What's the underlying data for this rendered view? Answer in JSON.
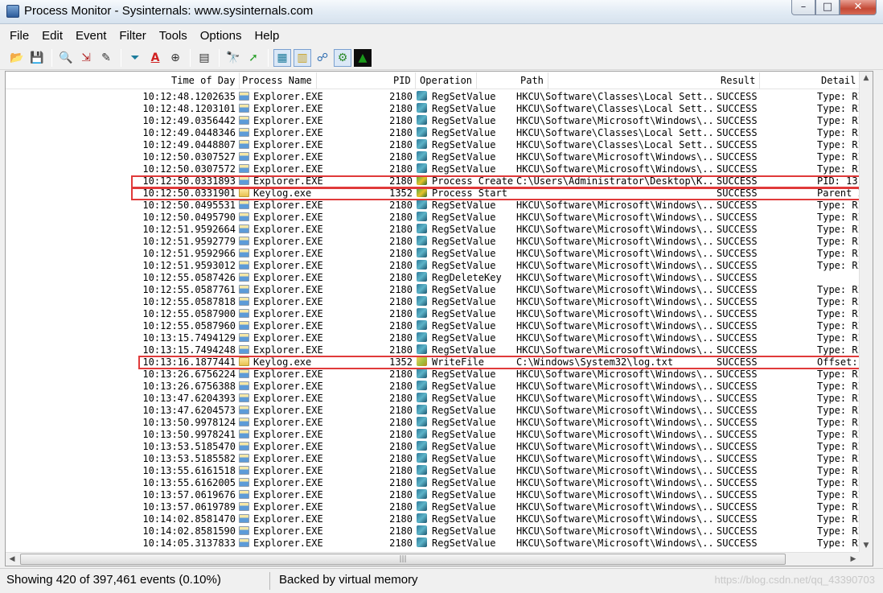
{
  "window": {
    "title": "Process Monitor - Sysinternals: www.sysinternals.com"
  },
  "menu": [
    "File",
    "Edit",
    "Event",
    "Filter",
    "Tools",
    "Options",
    "Help"
  ],
  "toolbar": {
    "buttons": [
      {
        "icon": "open-folder-icon",
        "glyph": "📂"
      },
      {
        "icon": "save-icon",
        "glyph": "💾"
      },
      {
        "icon": "capture-magnifier-icon",
        "glyph": "🔍"
      },
      {
        "icon": "autoscroll-icon",
        "glyph": "⇲"
      },
      {
        "icon": "clear-display-icon",
        "glyph": "✎"
      },
      {
        "icon": "filter-icon",
        "glyph": "⏷"
      },
      {
        "icon": "highlight-icon",
        "glyph": "A"
      },
      {
        "icon": "target-icon",
        "glyph": "⊕"
      },
      {
        "icon": "event-properties-icon",
        "glyph": "▤"
      },
      {
        "icon": "find-binoculars-icon",
        "glyph": "🔭"
      },
      {
        "icon": "jump-to-icon",
        "glyph": "➚"
      },
      {
        "icon": "registry-activity-icon",
        "glyph": "▦"
      },
      {
        "icon": "file-activity-icon",
        "glyph": "▥"
      },
      {
        "icon": "network-activity-icon",
        "glyph": "☍"
      },
      {
        "icon": "process-thread-activity-icon",
        "glyph": "⚙"
      },
      {
        "icon": "profiling-events-icon",
        "glyph": "▲"
      }
    ]
  },
  "columns": {
    "time": "Time of Day",
    "process": "Process Name",
    "pid": "PID",
    "operation": "Operation",
    "path": "Path",
    "result": "Result",
    "detail": "Detail"
  },
  "rows": [
    {
      "time": "10:12:48.1202635",
      "proc": "Explorer.EXE",
      "pid": "2180",
      "op": "RegSetValue",
      "path": "HKCU\\Software\\Classes\\Local Sett...",
      "result": "SUCCESS",
      "detail": "Type: RI"
    },
    {
      "time": "10:12:48.1203101",
      "proc": "Explorer.EXE",
      "pid": "2180",
      "op": "RegSetValue",
      "path": "HKCU\\Software\\Classes\\Local Sett...",
      "result": "SUCCESS",
      "detail": "Type: RI"
    },
    {
      "time": "10:12:49.0356442",
      "proc": "Explorer.EXE",
      "pid": "2180",
      "op": "RegSetValue",
      "path": "HKCU\\Software\\Microsoft\\Windows\\...",
      "result": "SUCCESS",
      "detail": "Type: RI"
    },
    {
      "time": "10:12:49.0448346",
      "proc": "Explorer.EXE",
      "pid": "2180",
      "op": "RegSetValue",
      "path": "HKCU\\Software\\Classes\\Local Sett...",
      "result": "SUCCESS",
      "detail": "Type: RI"
    },
    {
      "time": "10:12:49.0448807",
      "proc": "Explorer.EXE",
      "pid": "2180",
      "op": "RegSetValue",
      "path": "HKCU\\Software\\Classes\\Local Sett...",
      "result": "SUCCESS",
      "detail": "Type: RI"
    },
    {
      "time": "10:12:50.0307527",
      "proc": "Explorer.EXE",
      "pid": "2180",
      "op": "RegSetValue",
      "path": "HKCU\\Software\\Microsoft\\Windows\\...",
      "result": "SUCCESS",
      "detail": "Type: RI"
    },
    {
      "time": "10:12:50.0307572",
      "proc": "Explorer.EXE",
      "pid": "2180",
      "op": "RegSetValue",
      "path": "HKCU\\Software\\Microsoft\\Windows\\...",
      "result": "SUCCESS",
      "detail": "Type: RI"
    },
    {
      "time": "10:12:50.0331893",
      "proc": "Explorer.EXE",
      "pid": "2180",
      "op": "Process Create",
      "path": "C:\\Users\\Administrator\\Desktop\\K...",
      "result": "SUCCESS",
      "detail": "PID: 13"
    },
    {
      "time": "10:12:50.0331901",
      "proc": "Keylog.exe",
      "pid": "1352",
      "op": "Process Start",
      "path": "",
      "result": "SUCCESS",
      "detail": "Parent I"
    },
    {
      "time": "10:12:50.0495531",
      "proc": "Explorer.EXE",
      "pid": "2180",
      "op": "RegSetValue",
      "path": "HKCU\\Software\\Microsoft\\Windows\\...",
      "result": "SUCCESS",
      "detail": "Type: RI"
    },
    {
      "time": "10:12:50.0495790",
      "proc": "Explorer.EXE",
      "pid": "2180",
      "op": "RegSetValue",
      "path": "HKCU\\Software\\Microsoft\\Windows\\...",
      "result": "SUCCESS",
      "detail": "Type: RI"
    },
    {
      "time": "10:12:51.9592664",
      "proc": "Explorer.EXE",
      "pid": "2180",
      "op": "RegSetValue",
      "path": "HKCU\\Software\\Microsoft\\Windows\\...",
      "result": "SUCCESS",
      "detail": "Type: RI"
    },
    {
      "time": "10:12:51.9592779",
      "proc": "Explorer.EXE",
      "pid": "2180",
      "op": "RegSetValue",
      "path": "HKCU\\Software\\Microsoft\\Windows\\...",
      "result": "SUCCESS",
      "detail": "Type: RI"
    },
    {
      "time": "10:12:51.9592966",
      "proc": "Explorer.EXE",
      "pid": "2180",
      "op": "RegSetValue",
      "path": "HKCU\\Software\\Microsoft\\Windows\\...",
      "result": "SUCCESS",
      "detail": "Type: RI"
    },
    {
      "time": "10:12:51.9593012",
      "proc": "Explorer.EXE",
      "pid": "2180",
      "op": "RegSetValue",
      "path": "HKCU\\Software\\Microsoft\\Windows\\...",
      "result": "SUCCESS",
      "detail": "Type: RI"
    },
    {
      "time": "10:12:55.0587426",
      "proc": "Explorer.EXE",
      "pid": "2180",
      "op": "RegDeleteKey",
      "path": "HKCU\\Software\\Microsoft\\Windows\\...",
      "result": "SUCCESS",
      "detail": ""
    },
    {
      "time": "10:12:55.0587761",
      "proc": "Explorer.EXE",
      "pid": "2180",
      "op": "RegSetValue",
      "path": "HKCU\\Software\\Microsoft\\Windows\\...",
      "result": "SUCCESS",
      "detail": "Type: RI"
    },
    {
      "time": "10:12:55.0587818",
      "proc": "Explorer.EXE",
      "pid": "2180",
      "op": "RegSetValue",
      "path": "HKCU\\Software\\Microsoft\\Windows\\...",
      "result": "SUCCESS",
      "detail": "Type: RI"
    },
    {
      "time": "10:12:55.0587900",
      "proc": "Explorer.EXE",
      "pid": "2180",
      "op": "RegSetValue",
      "path": "HKCU\\Software\\Microsoft\\Windows\\...",
      "result": "SUCCESS",
      "detail": "Type: RI"
    },
    {
      "time": "10:12:55.0587960",
      "proc": "Explorer.EXE",
      "pid": "2180",
      "op": "RegSetValue",
      "path": "HKCU\\Software\\Microsoft\\Windows\\...",
      "result": "SUCCESS",
      "detail": "Type: RI"
    },
    {
      "time": "10:13:15.7494129",
      "proc": "Explorer.EXE",
      "pid": "2180",
      "op": "RegSetValue",
      "path": "HKCU\\Software\\Microsoft\\Windows\\...",
      "result": "SUCCESS",
      "detail": "Type: RI"
    },
    {
      "time": "10:13:15.7494248",
      "proc": "Explorer.EXE",
      "pid": "2180",
      "op": "RegSetValue",
      "path": "HKCU\\Software\\Microsoft\\Windows\\...",
      "result": "SUCCESS",
      "detail": "Type: RI"
    },
    {
      "time": "10:13:16.1877441",
      "proc": "Keylog.exe",
      "pid": "1352",
      "op": "WriteFile",
      "path": "C:\\Windows\\System32\\log.txt",
      "result": "SUCCESS",
      "detail": "Offset:"
    },
    {
      "time": "10:13:26.6756224",
      "proc": "Explorer.EXE",
      "pid": "2180",
      "op": "RegSetValue",
      "path": "HKCU\\Software\\Microsoft\\Windows\\...",
      "result": "SUCCESS",
      "detail": "Type: RI"
    },
    {
      "time": "10:13:26.6756388",
      "proc": "Explorer.EXE",
      "pid": "2180",
      "op": "RegSetValue",
      "path": "HKCU\\Software\\Microsoft\\Windows\\...",
      "result": "SUCCESS",
      "detail": "Type: RI"
    },
    {
      "time": "10:13:47.6204393",
      "proc": "Explorer.EXE",
      "pid": "2180",
      "op": "RegSetValue",
      "path": "HKCU\\Software\\Microsoft\\Windows\\...",
      "result": "SUCCESS",
      "detail": "Type: RI"
    },
    {
      "time": "10:13:47.6204573",
      "proc": "Explorer.EXE",
      "pid": "2180",
      "op": "RegSetValue",
      "path": "HKCU\\Software\\Microsoft\\Windows\\...",
      "result": "SUCCESS",
      "detail": "Type: RI"
    },
    {
      "time": "10:13:50.9978124",
      "proc": "Explorer.EXE",
      "pid": "2180",
      "op": "RegSetValue",
      "path": "HKCU\\Software\\Microsoft\\Windows\\...",
      "result": "SUCCESS",
      "detail": "Type: RI"
    },
    {
      "time": "10:13:50.9978241",
      "proc": "Explorer.EXE",
      "pid": "2180",
      "op": "RegSetValue",
      "path": "HKCU\\Software\\Microsoft\\Windows\\...",
      "result": "SUCCESS",
      "detail": "Type: RI"
    },
    {
      "time": "10:13:53.5185470",
      "proc": "Explorer.EXE",
      "pid": "2180",
      "op": "RegSetValue",
      "path": "HKCU\\Software\\Microsoft\\Windows\\...",
      "result": "SUCCESS",
      "detail": "Type: RI"
    },
    {
      "time": "10:13:53.5185582",
      "proc": "Explorer.EXE",
      "pid": "2180",
      "op": "RegSetValue",
      "path": "HKCU\\Software\\Microsoft\\Windows\\...",
      "result": "SUCCESS",
      "detail": "Type: RI"
    },
    {
      "time": "10:13:55.6161518",
      "proc": "Explorer.EXE",
      "pid": "2180",
      "op": "RegSetValue",
      "path": "HKCU\\Software\\Microsoft\\Windows\\...",
      "result": "SUCCESS",
      "detail": "Type: RI"
    },
    {
      "time": "10:13:55.6162005",
      "proc": "Explorer.EXE",
      "pid": "2180",
      "op": "RegSetValue",
      "path": "HKCU\\Software\\Microsoft\\Windows\\...",
      "result": "SUCCESS",
      "detail": "Type: RI"
    },
    {
      "time": "10:13:57.0619676",
      "proc": "Explorer.EXE",
      "pid": "2180",
      "op": "RegSetValue",
      "path": "HKCU\\Software\\Microsoft\\Windows\\...",
      "result": "SUCCESS",
      "detail": "Type: RI"
    },
    {
      "time": "10:13:57.0619789",
      "proc": "Explorer.EXE",
      "pid": "2180",
      "op": "RegSetValue",
      "path": "HKCU\\Software\\Microsoft\\Windows\\...",
      "result": "SUCCESS",
      "detail": "Type: RI"
    },
    {
      "time": "10:14:02.8581470",
      "proc": "Explorer.EXE",
      "pid": "2180",
      "op": "RegSetValue",
      "path": "HKCU\\Software\\Microsoft\\Windows\\...",
      "result": "SUCCESS",
      "detail": "Type: RI"
    },
    {
      "time": "10:14:02.8581590",
      "proc": "Explorer.EXE",
      "pid": "2180",
      "op": "RegSetValue",
      "path": "HKCU\\Software\\Microsoft\\Windows\\...",
      "result": "SUCCESS",
      "detail": "Type: RI"
    },
    {
      "time": "10:14:05.3137833",
      "proc": "Explorer.EXE",
      "pid": "2180",
      "op": "RegSetValue",
      "path": "HKCU\\Software\\Microsoft\\Windows\\...",
      "result": "SUCCESS",
      "detail": "Type: RI"
    }
  ],
  "highlighted_rows": [
    7,
    8,
    22
  ],
  "highlight_color": "#e03a3a",
  "status": {
    "events": "Showing 420 of 397,461 events (0.10%)",
    "memory": "Backed by virtual memory",
    "watermark": "https://blog.csdn.net/qq_43390703"
  }
}
